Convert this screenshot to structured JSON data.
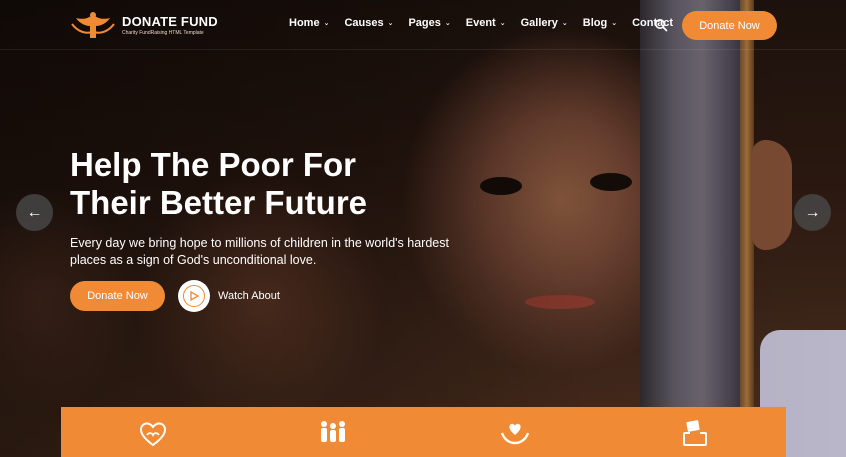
{
  "brand": {
    "name": "DONATE FUND",
    "tagline": "Charity FundRaising HTML Template",
    "accent": "#f08a34"
  },
  "nav": {
    "items": [
      {
        "label": "Home",
        "dropdown": true
      },
      {
        "label": "Causes",
        "dropdown": true
      },
      {
        "label": "Pages",
        "dropdown": true
      },
      {
        "label": "Event",
        "dropdown": true
      },
      {
        "label": "Gallery",
        "dropdown": true
      },
      {
        "label": "Blog",
        "dropdown": true
      },
      {
        "label": "Contact",
        "dropdown": false
      }
    ],
    "search_icon": "search-icon",
    "donate_label": "Donate Now"
  },
  "hero": {
    "headline_line1": "Help The Poor For",
    "headline_line2": "Their Better Future",
    "description": "Every day we bring hope to millions of children in the world's hardest places as a sign of God's unconditional love.",
    "donate_label": "Donate Now",
    "watch_label": "Watch About",
    "prev_arrow": "←",
    "next_arrow": "→"
  },
  "features": {
    "icons": [
      "heart-hands-icon",
      "family-icon",
      "hands-heart-icon",
      "donation-box-icon"
    ]
  }
}
